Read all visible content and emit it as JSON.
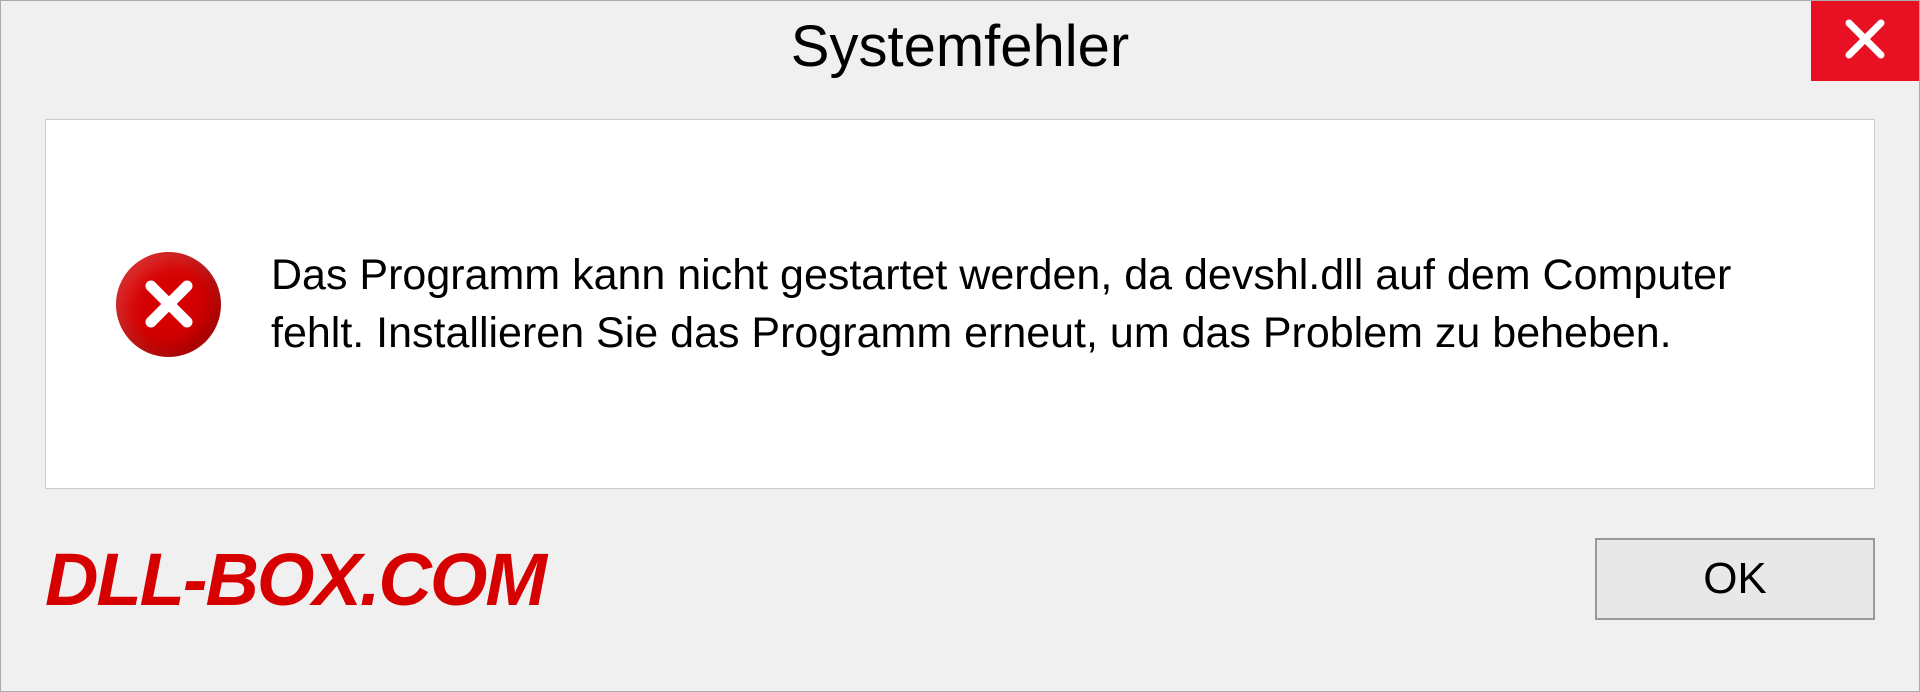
{
  "dialog": {
    "title": "Systemfehler",
    "message": "Das Programm kann nicht gestartet werden, da devshl.dll auf dem Computer fehlt. Installieren Sie das Programm erneut, um das Problem zu beheben.",
    "ok_label": "OK"
  },
  "watermark": {
    "text": "DLL-BOX.COM"
  },
  "colors": {
    "error_red": "#d60000",
    "close_red": "#e81123"
  }
}
